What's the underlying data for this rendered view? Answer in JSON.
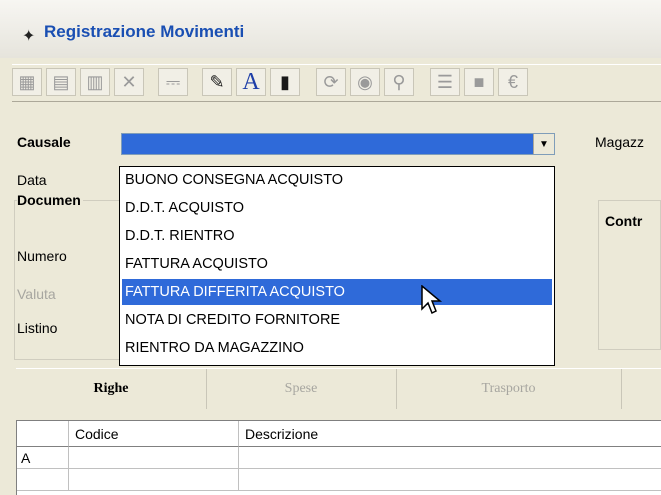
{
  "window": {
    "title": "Registrazione Movimenti"
  },
  "toolbar": {
    "icons": [
      "folder-icon",
      "folder-open-icon",
      "search-doc-icon",
      "delete-icon",
      "print-icon",
      "edit-icon",
      "font-icon",
      "barcode-icon",
      "refresh-icon",
      "world-icon",
      "binoculars-icon",
      "list-icon",
      "square-icon",
      "euro-icon"
    ],
    "font_label": "A"
  },
  "form": {
    "causale_label": "Causale",
    "magazzino_label": "Magazz",
    "data_label": "Data",
    "documento_label": "Documen",
    "numero_label": "Numero",
    "valuta_label": "Valuta",
    "listino_label": "Listino",
    "contr_label": "Contr",
    "causale_value": ""
  },
  "dropdown": {
    "options": [
      "BUONO CONSEGNA ACQUISTO",
      "D.D.T. ACQUISTO",
      "D.D.T. RIENTRO",
      "FATTURA ACQUISTO",
      "FATTURA DIFFERITA ACQUISTO",
      "NOTA DI CREDITO FORNITORE",
      "RIENTRO DA MAGAZZINO"
    ],
    "selected": "FATTURA DIFFERITA ACQUISTO"
  },
  "tabs": [
    "Righe",
    "Spese",
    "Trasporto"
  ],
  "grid": {
    "headers": [
      "Codice",
      "Descrizione"
    ],
    "rows": [
      [
        "A",
        "",
        ""
      ]
    ]
  }
}
